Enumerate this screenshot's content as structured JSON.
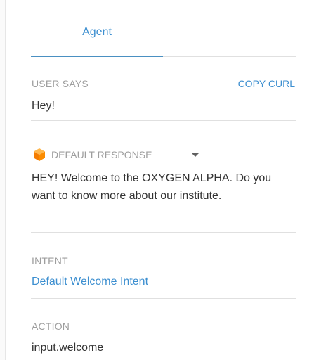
{
  "tabs": {
    "agent_label": "Agent"
  },
  "user_says": {
    "label": "USER SAYS",
    "copy_curl_label": "COPY CURL",
    "value": "Hey!"
  },
  "default_response": {
    "icon": "cube-icon",
    "icon_color": "#f5a623",
    "label": "DEFAULT RESPONSE",
    "text": "HEY! Welcome to the OXYGEN ALPHA. Do you want to know more about our institute."
  },
  "intent": {
    "label": "INTENT",
    "value": "Default Welcome Intent"
  },
  "action": {
    "label": "ACTION",
    "value": "input.welcome"
  },
  "colors": {
    "accent": "#3d8fd0",
    "muted_label": "#9e9e9e",
    "body_text": "#333333"
  }
}
